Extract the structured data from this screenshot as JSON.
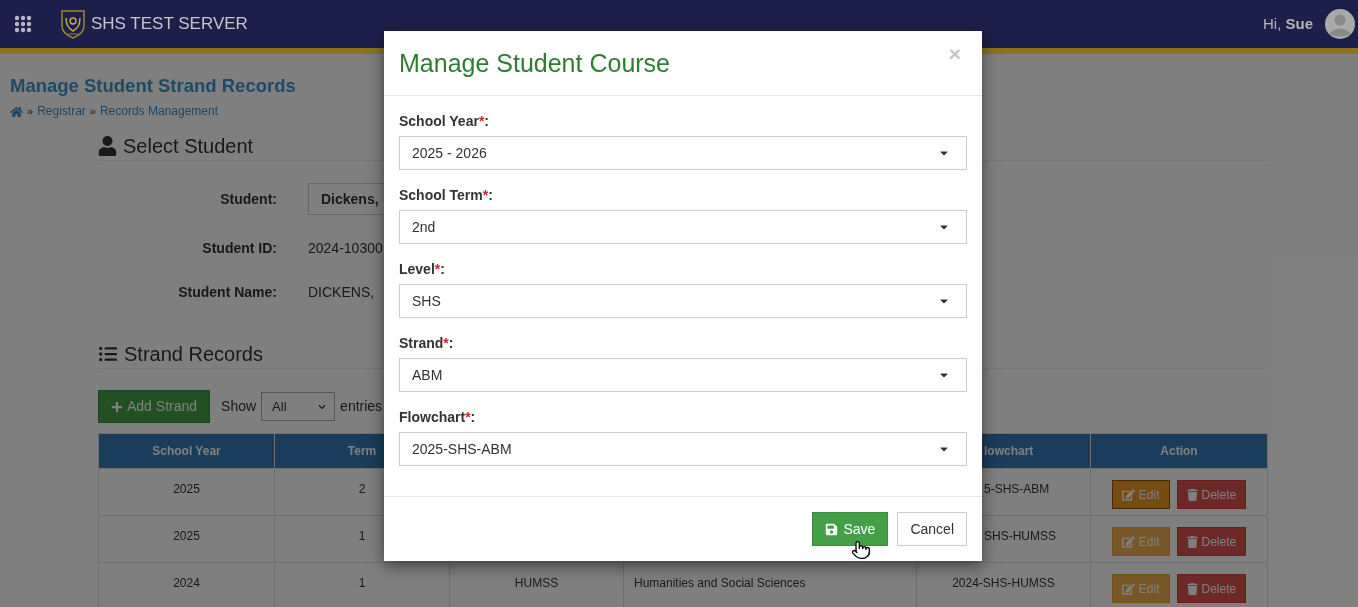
{
  "navbar": {
    "title": "SHS TEST SERVER",
    "greeting": "Hi, **Sue**"
  },
  "page": {
    "title": "Manage Student Strand Records",
    "breadcrumb": [
      {
        "kind": "home"
      },
      {
        "kind": "separator",
        "text": "»"
      },
      {
        "kind": "link",
        "text": "Registrar"
      },
      {
        "kind": "separator",
        "text": "»"
      },
      {
        "kind": "link",
        "text": "Records Management"
      }
    ]
  },
  "select_student": {
    "heading": "Select Student",
    "fields": [
      {
        "kind": "select",
        "label": "Student:",
        "value": "Dickens,"
      },
      {
        "kind": "text",
        "label": "Student ID:",
        "value": "2024-10300"
      },
      {
        "kind": "text",
        "label": "Student Name:",
        "value": "DICKENS,"
      }
    ]
  },
  "strand_records": {
    "heading": "Strand Records",
    "add_button": "Add Strand",
    "show_label": "Show",
    "show_value": "All",
    "entries_label": "entries",
    "table": {
      "header": {
        "school_year": "School Year",
        "term": "Term",
        "column_5": "lowchart",
        "action": "Action"
      },
      "rows": [
        {
          "school_year": "2025",
          "term": "2",
          "column_5": "5-SHS-ABM",
          "edit": {
            "label": "Edit",
            "focused": true
          },
          "delete": "Delete"
        },
        {
          "school_year": "2025",
          "term": "1",
          "column_5": "SHS-HUMSS",
          "edit": {
            "label": "Edit",
            "focused": false
          },
          "delete": "Delete"
        },
        {
          "school_year": "2024",
          "term": "1",
          "column_3": "HUMSS",
          "column_4": "Humanities and Social Sciences",
          "column_5": "2024-SHS-HUMSS",
          "edit": {
            "label": "Edit",
            "focused": false
          },
          "delete": "Delete"
        }
      ]
    }
  },
  "modal": {
    "title": "Manage Student Course",
    "close": "×",
    "fields": [
      {
        "label": "School Year",
        "required": "*",
        "suffix": ":",
        "value": "2025 - 2026"
      },
      {
        "label": "School Term",
        "required": "*",
        "suffix": ":",
        "value": "2nd"
      },
      {
        "label": "Level",
        "required": "*",
        "suffix": ":",
        "value": "SHS"
      },
      {
        "label": "Strand",
        "required": "*",
        "suffix": ":",
        "value": "ABM"
      },
      {
        "label": "Flowchart",
        "required": "*",
        "suffix": ":",
        "value": "2025-SHS-ABM"
      }
    ],
    "buttons": [
      {
        "kind": "primary",
        "label": "Save"
      },
      {
        "kind": "default",
        "label": "Cancel"
      }
    ]
  }
}
